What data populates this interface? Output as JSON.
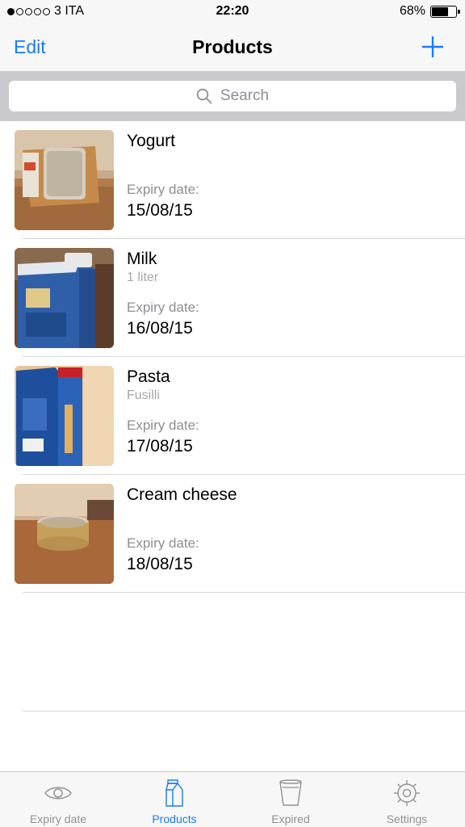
{
  "status": {
    "carrier": "3 ITA",
    "time": "22:20",
    "battery": "68%",
    "battery_level": 0.68
  },
  "nav": {
    "edit_label": "Edit",
    "title": "Products"
  },
  "search": {
    "placeholder": "Search"
  },
  "products": [
    {
      "name": "Yogurt",
      "subtitle": "",
      "expiry_label": "Expiry date:",
      "expiry_date": "15/08/15"
    },
    {
      "name": "Milk",
      "subtitle": "1 liter",
      "expiry_label": "Expiry date:",
      "expiry_date": "16/08/15"
    },
    {
      "name": "Pasta",
      "subtitle": "Fusilli",
      "expiry_label": "Expiry date:",
      "expiry_date": "17/08/15"
    },
    {
      "name": "Cream cheese",
      "subtitle": "",
      "expiry_label": "Expiry date:",
      "expiry_date": "18/08/15"
    }
  ],
  "tabs": [
    {
      "label": "Expiry date",
      "icon": "eye-icon"
    },
    {
      "label": "Products",
      "icon": "milk-carton-icon",
      "active": true
    },
    {
      "label": "Expired",
      "icon": "trash-cup-icon"
    },
    {
      "label": "Settings",
      "icon": "gear-icon"
    }
  ],
  "colors": {
    "accent": "#1a7cf3",
    "inactive_tab": "#929292",
    "bar_background": "#f7f7f7",
    "search_background": "#c9c9ce"
  }
}
